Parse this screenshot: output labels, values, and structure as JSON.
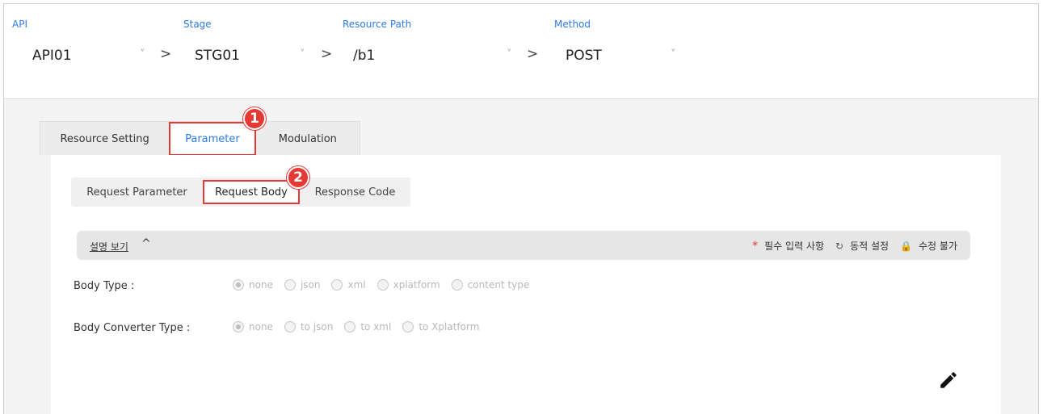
{
  "selectors": {
    "api": {
      "label": "API",
      "value": "API01"
    },
    "stage": {
      "label": "Stage",
      "value": "STG01"
    },
    "resource_path": {
      "label": "Resource Path",
      "value": "/b1"
    },
    "method": {
      "label": "Method",
      "value": "POST"
    },
    "chevron": "˅",
    "separator": ">"
  },
  "tabs": [
    {
      "label": "Resource Setting",
      "active": false
    },
    {
      "label": "Parameter",
      "active": true
    },
    {
      "label": "Modulation",
      "active": false
    }
  ],
  "subtabs": [
    {
      "label": "Request Parameter",
      "active": false
    },
    {
      "label": "Request Body",
      "active": true
    },
    {
      "label": "Response Code",
      "active": false
    }
  ],
  "annotations": {
    "badge1": "1",
    "badge2": "2"
  },
  "description_bar": {
    "toggle_label": "설명 보기",
    "caret": "^",
    "legend": {
      "required_symbol": "*",
      "required_label": "필수 입력 사항",
      "dynamic_symbol": "↻",
      "dynamic_label": "동적 설정",
      "locked_symbol": "🔒",
      "locked_label": "수정 불가"
    }
  },
  "form": {
    "body_type": {
      "label": "Body Type :",
      "options": [
        "none",
        "json",
        "xml",
        "xplatform",
        "content type"
      ],
      "selected": "none"
    },
    "body_converter_type": {
      "label": "Body Converter Type :",
      "options": [
        "none",
        "to json",
        "to xml",
        "to Xplatform"
      ],
      "selected": "none"
    }
  },
  "colors": {
    "accent_blue": "#2d7be5",
    "highlight_red": "#e53935"
  },
  "icons": {
    "edit": "pencil-icon"
  }
}
